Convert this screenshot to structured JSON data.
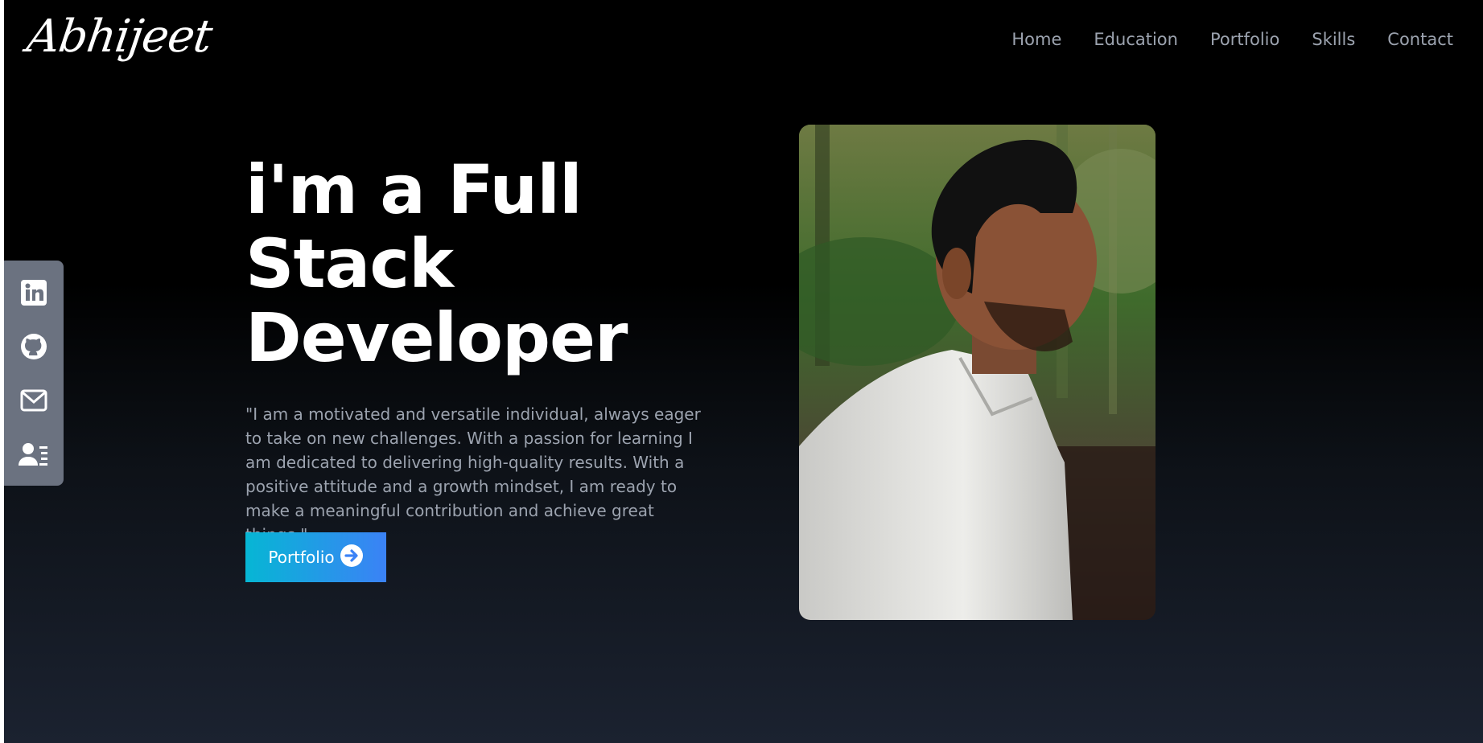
{
  "logo": {
    "text": "Abhijeet"
  },
  "nav": {
    "home": "Home",
    "education": "Education",
    "portfolio": "Portfolio",
    "skills": "Skills",
    "contact": "Contact"
  },
  "social": {
    "icons": [
      "linkedin-icon",
      "github-icon",
      "mail-icon",
      "contact-card-icon"
    ]
  },
  "hero": {
    "headline_line1": "i'm a Full",
    "headline_line2": "Stack",
    "headline_line3": "Developer",
    "bio": "\"I am a motivated and versatile individual, always eager to take on new challenges. With a passion for learning I am dedicated to delivering high-quality results. With a positive attitude and a growth mindset, I am ready to make a meaningful contribution and achieve great things.\",",
    "button_label": "Portfolio"
  },
  "colors": {
    "accent_start": "#06b6d4",
    "accent_end": "#3b82f6",
    "nav_text": "#9ca3af",
    "sidebar": "#6b7280"
  }
}
